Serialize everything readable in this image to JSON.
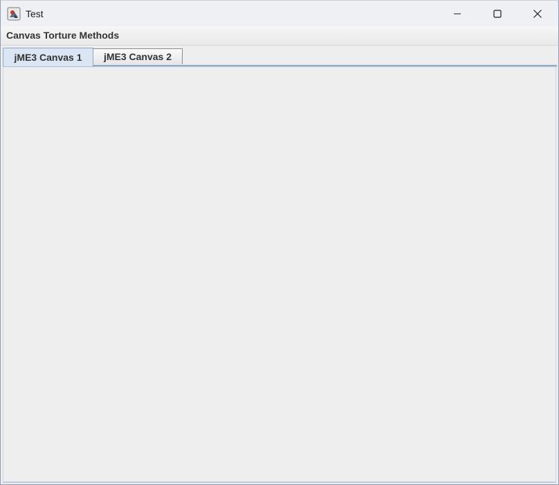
{
  "window": {
    "title": "Test",
    "icon": "java-app-icon",
    "controls": [
      "minimize-icon",
      "maximize-icon",
      "close-icon"
    ]
  },
  "menubar": {
    "items": [
      {
        "label": "Canvas Torture Methods"
      }
    ]
  },
  "tabs": [
    {
      "label": "jME3 Canvas 1",
      "selected": true
    },
    {
      "label": "jME3 Canvas 2",
      "selected": false
    }
  ],
  "colors": {
    "selected_tab": "#dbe6f4",
    "tab_underline": "#a9bedb",
    "content_bg": "#eeeeee",
    "titlebar_bg": "#eef0f4"
  }
}
